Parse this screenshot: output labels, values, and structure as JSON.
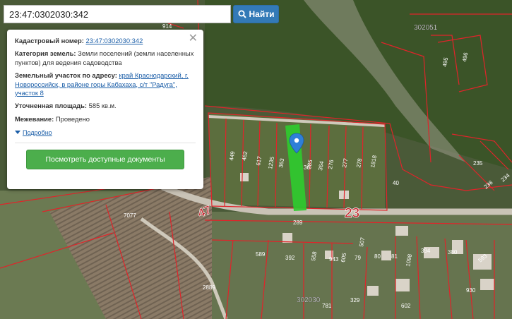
{
  "search": {
    "value": "23:47:0302030:342",
    "button_label": "Найти",
    "button_icon": "search-icon"
  },
  "popup": {
    "cadastral_label": "Кадастровый номер:",
    "cadastral_value": "23:47:0302030:342",
    "category_label": "Категория земель:",
    "category_value": "Земли поселений (земли населенных пунктов) для ведения садоводства",
    "address_label": "Земельный участок по адресу:",
    "address_value": "край Краснодарский, г. Новороссийск, в районе горы Кабахаха, с/т \"Радуга\", участок 8",
    "area_label": "Уточненная площадь:",
    "area_value": "585 кв.м.",
    "survey_label": "Межевание:",
    "survey_value": "Проведено",
    "more_label": "Подробно",
    "docs_button": "Посмотреть доступные документы",
    "close_icon": "close-icon"
  },
  "map": {
    "quarter_labels": [
      "302051",
      "302030"
    ],
    "road_labels": [
      "23",
      "47"
    ],
    "parcel_numbers": [
      "914",
      "495",
      "496",
      "449",
      "462",
      "617",
      "1235",
      "363",
      "36",
      "385",
      "364",
      "276",
      "277",
      "278",
      "1818",
      "40",
      "235",
      "236",
      "234",
      "7077",
      "289",
      "589",
      "392",
      "558",
      "943",
      "605",
      "79",
      "507",
      "80",
      "81",
      "1098",
      "394",
      "380",
      "593",
      "930",
      "2889",
      "781",
      "329",
      "602"
    ],
    "colors": {
      "boundary": "#e0242a",
      "selected_parcel": "#2ecc2e",
      "marker": "#2f7fd8",
      "button_primary": "#337ab7",
      "button_success": "#4cae4c"
    },
    "marker_icon": "map-pin-icon"
  }
}
